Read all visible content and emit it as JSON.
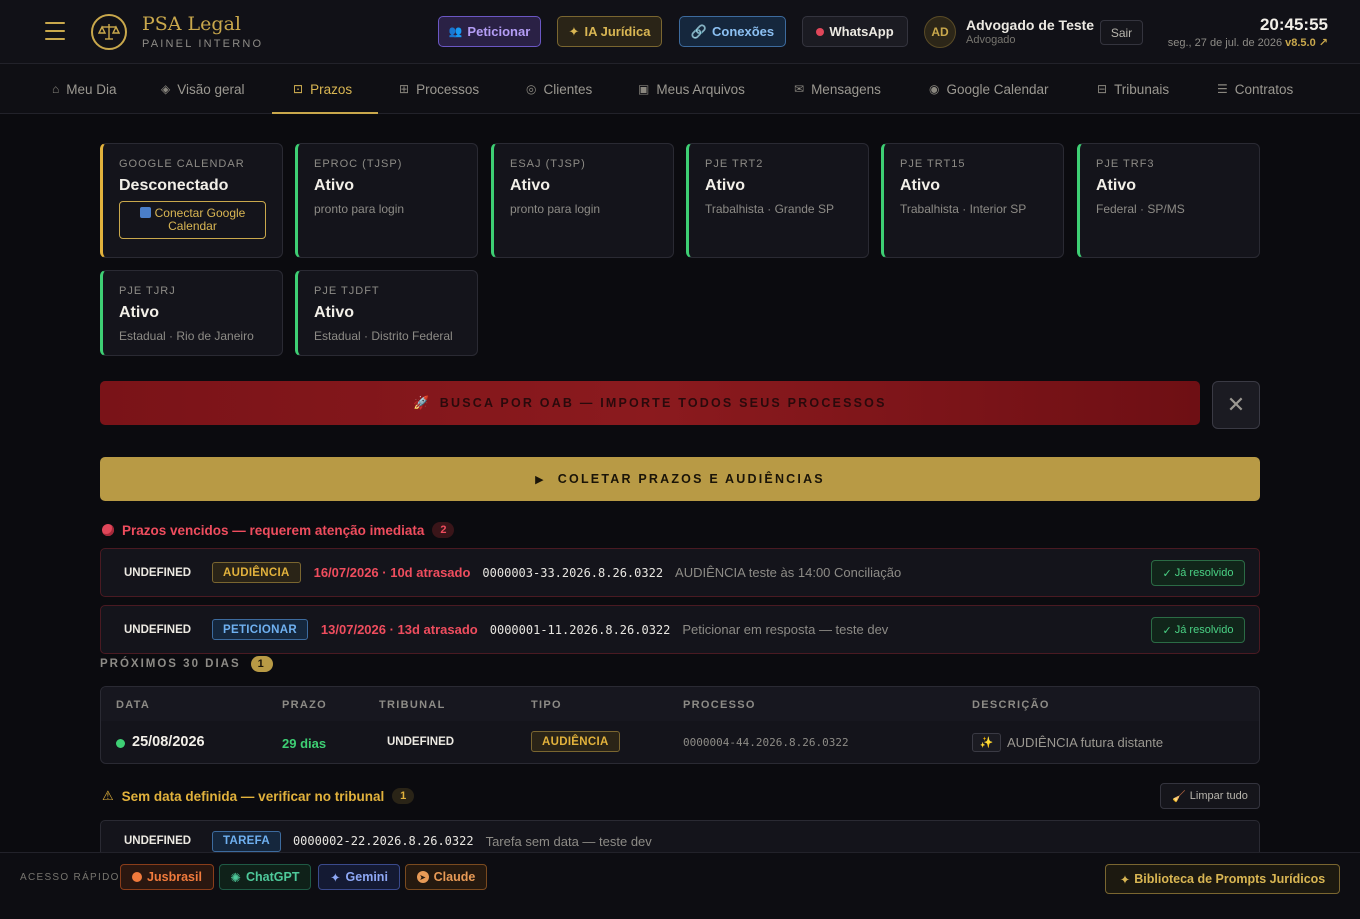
{
  "header": {
    "brand_title": "PSA Legal",
    "brand_subtitle": "PAINEL INTERNO",
    "buttons": {
      "peticionar": "Peticionar",
      "ia_juridica": "IA Jurídica",
      "conexoes": "Conexões",
      "whatsapp": "WhatsApp"
    },
    "user": {
      "initials": "AD",
      "name": "Advogado de Teste",
      "role": "Advogado",
      "logout": "Sair"
    },
    "clock": "20:45:55",
    "date": "seg., 27 de jul. de 2026",
    "version": "v8.5.0 ↗"
  },
  "nav": {
    "tabs": [
      {
        "label": "Meu Dia",
        "icon": "⌂"
      },
      {
        "label": "Visão geral",
        "icon": "◈"
      },
      {
        "label": "Prazos",
        "icon": "⊡"
      },
      {
        "label": "Processos",
        "icon": "⊞"
      },
      {
        "label": "Clientes",
        "icon": "◎"
      },
      {
        "label": "Meus Arquivos",
        "icon": "▣"
      },
      {
        "label": "Mensagens",
        "icon": "✉"
      },
      {
        "label": "Google Calendar",
        "icon": "◉"
      },
      {
        "label": "Tribunais",
        "icon": "⊟"
      },
      {
        "label": "Contratos",
        "icon": "☰"
      }
    ],
    "active": "Prazos"
  },
  "status_cards": [
    {
      "label": "GOOGLE CALENDAR",
      "status": "Desconectado",
      "action": "Conectar Google Calendar"
    },
    {
      "label": "EPROC (TJSP)",
      "status": "Ativo",
      "detail": "pronto para login"
    },
    {
      "label": "ESAJ (TJSP)",
      "status": "Ativo",
      "detail": "pronto para login"
    },
    {
      "label": "PJE TRT2",
      "status": "Ativo",
      "detail": "Trabalhista · Grande SP"
    },
    {
      "label": "PJE TRT15",
      "status": "Ativo",
      "detail": "Trabalhista · Interior SP"
    },
    {
      "label": "PJE TRF3",
      "status": "Ativo",
      "detail": "Federal · SP/MS"
    },
    {
      "label": "PJE TJRJ",
      "status": "Ativo",
      "detail": "Estadual · Rio de Janeiro"
    },
    {
      "label": "PJE TJDFT",
      "status": "Ativo",
      "detail": "Estadual · Distrito Federal"
    }
  ],
  "oab_banner": "BUSCA POR OAB — IMPORTE TODOS SEUS PROCESSOS",
  "collect_button": "COLETAR PRAZOS E AUDIÊNCIAS",
  "overdue": {
    "title": "Prazos vencidos — requerem atenção imediata",
    "count": "2",
    "rows": [
      {
        "tribunal": "UNDEFINED",
        "type": "AUDIÊNCIA",
        "late": "16/07/2026 · 10d atrasado",
        "process": "0000003-33.2026.8.26.0322",
        "description": "AUDIÊNCIA teste às 14:00 Conciliação",
        "action": "Já resolvido"
      },
      {
        "tribunal": "UNDEFINED",
        "type": "PETICIONAR",
        "late": "13/07/2026 · 13d atrasado",
        "process": "0000001-11.2026.8.26.0322",
        "description": "Peticionar em resposta — teste dev",
        "action": "Já resolvido"
      }
    ]
  },
  "next30": {
    "title": "PRÓXIMOS 30 DIAS",
    "count": "1",
    "columns": [
      "DATA",
      "PRAZO",
      "TRIBUNAL",
      "TIPO",
      "PROCESSO",
      "DESCRIÇÃO"
    ],
    "rows": [
      {
        "date": "25/08/2026",
        "deadline": "29 dias",
        "tribunal": "UNDEFINED",
        "type": "AUDIÊNCIA",
        "process": "0000004-44.2026.8.26.0322",
        "description": "AUDIÊNCIA futura distante"
      }
    ]
  },
  "no_date": {
    "title": "Sem data definida — verificar no tribunal",
    "count": "1",
    "clear_label": "Limpar tudo",
    "rows": [
      {
        "tribunal": "UNDEFINED",
        "type": "TAREFA",
        "process": "0000002-22.2026.8.26.0322",
        "description": "Tarefa sem data — teste dev"
      }
    ]
  },
  "footer": {
    "quick_access": "ACESSO RÁPIDO",
    "links": [
      "Jusbrasil",
      "ChatGPT",
      "Gemini",
      "Claude"
    ],
    "library": "Biblioteca de Prompts Jurídicos"
  }
}
